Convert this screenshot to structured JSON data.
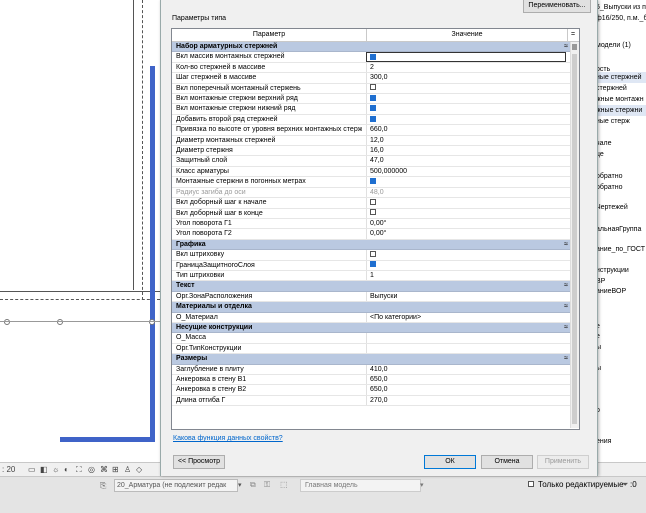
{
  "dialog": {
    "title_fragment": "",
    "rename_button": "Переименовать...",
    "type_params_label": "Параметры типа",
    "col_param": "Параметр",
    "col_value": "Значение",
    "col_equals": "=",
    "help_link": "Какова функция данных свойств?",
    "preview_button": "<< Просмотр",
    "ok_button": "ОК",
    "cancel_button": "Отмена",
    "apply_button": "Применить",
    "rows": [
      {
        "kind": "section",
        "name": "Набор арматурных стержней"
      },
      {
        "name": "Вкл массив монтажных стержней",
        "type": "check",
        "checked": true,
        "selected": true
      },
      {
        "name": "Кол-во стержней в массиве",
        "type": "text",
        "value": "2"
      },
      {
        "name": "Шаг стержней в массиве",
        "type": "text",
        "value": "300,0"
      },
      {
        "name": "Вкл поперечный монтажный стержень",
        "type": "check",
        "checked": false
      },
      {
        "name": "Вкл монтажные стержни верхний ряд",
        "type": "check",
        "checked": true
      },
      {
        "name": "Вкл монтажные стержни нижний ряд",
        "type": "check",
        "checked": true
      },
      {
        "name": "Добавить второй ряд стержней",
        "type": "check",
        "checked": true
      },
      {
        "name": "Привязка по высоте от уровня верхних монтажных стерж",
        "type": "text",
        "value": "660,0"
      },
      {
        "name": "Диаметр монтажных стержней",
        "type": "text",
        "value": "12,0"
      },
      {
        "name": "Диаметр стержня",
        "type": "text",
        "value": "16,0"
      },
      {
        "name": "Защитный слой",
        "type": "text",
        "value": "47,0"
      },
      {
        "name": "Класс арматуры",
        "type": "text",
        "value": "500,000000"
      },
      {
        "name": "Монтажные стержни в погонных метрах",
        "type": "check",
        "checked": true
      },
      {
        "name": "Радиус загиба до оси",
        "type": "text",
        "value": "48,0",
        "dim": true
      },
      {
        "name": "Вкл доборный шаг к начале",
        "type": "check",
        "checked": false
      },
      {
        "name": "Вкл доборный шаг в конце",
        "type": "check",
        "checked": false
      },
      {
        "name": "Угол поворота Г1",
        "type": "text",
        "value": "0,00°"
      },
      {
        "name": "Угол поворота Г2",
        "type": "text",
        "value": "0,00°"
      },
      {
        "kind": "section",
        "name": "Графика"
      },
      {
        "name": "Вкл штриховку",
        "type": "check",
        "checked": false
      },
      {
        "name": "ГраницаЗащитногоСлоя",
        "type": "check",
        "checked": true
      },
      {
        "name": "Тип штриховки",
        "type": "text",
        "value": "1"
      },
      {
        "kind": "section",
        "name": "Текст"
      },
      {
        "name": "Орг.ЗонаРасположения",
        "type": "text",
        "value": "Выпуски"
      },
      {
        "kind": "section",
        "name": "Материалы и отделка"
      },
      {
        "name": "О_Материал",
        "type": "text",
        "value": "<По категории>"
      },
      {
        "kind": "section",
        "name": "Несущие конструкции"
      },
      {
        "name": "О_Масса",
        "type": "text",
        "value": ""
      },
      {
        "name": "Орг.ТипКонструкции",
        "type": "text",
        "value": ""
      },
      {
        "kind": "section",
        "name": "Размеры"
      },
      {
        "name": "Заглубление в плиту",
        "type": "text",
        "value": "410,0"
      },
      {
        "name": "Анкеровка в стену В1",
        "type": "text",
        "value": "650,0"
      },
      {
        "name": "Анкеровка в стену В2",
        "type": "text",
        "value": "650,0"
      },
      {
        "name": "Длина отгиба Г",
        "type": "text",
        "value": "270,0"
      }
    ]
  },
  "right_panel": {
    "items": [
      {
        "text": "5_Выпуски из п",
        "style": ""
      },
      {
        "text": "ф16/250, п.м._б",
        "style": ""
      },
      {
        "text": "модели (1)",
        "style": ""
      },
      {
        "text": "ость",
        "style": ""
      },
      {
        "text": "ные стержней",
        "style": "hl"
      },
      {
        "text": "стержней",
        "style": ""
      },
      {
        "text": "жные монтажн",
        "style": ""
      },
      {
        "text": "жные стержни",
        "style": "hl"
      },
      {
        "text": "ные стерж",
        "style": ""
      },
      {
        "text": "чале",
        "style": ""
      },
      {
        "text": "це",
        "style": ""
      },
      {
        "text": "обратно",
        "style": ""
      },
      {
        "text": "обратно",
        "style": ""
      },
      {
        "text": "Чертежей",
        "style": ""
      },
      {
        "text": "альнаяГруппа",
        "style": ""
      },
      {
        "text": "ание_по_ГОСТ",
        "style": ""
      },
      {
        "text": "нструкции",
        "style": ""
      },
      {
        "text": "ВР",
        "style": ""
      },
      {
        "text": "аниеВОР",
        "style": ""
      },
      {
        "text": "е",
        "style": ""
      },
      {
        "text": "е",
        "style": ""
      },
      {
        "text": "ы",
        "style": ""
      },
      {
        "text": "ы",
        "style": ""
      },
      {
        "text": "р",
        "style": ""
      },
      {
        "text": "ения",
        "style": ""
      }
    ]
  },
  "status": {
    "scale": ": 20",
    "workset": "20_Арматура (не подлежит редак",
    "design_option": "Главная модель",
    "editable_only_label": "Только редактируемые",
    "filter_count": ":0"
  }
}
